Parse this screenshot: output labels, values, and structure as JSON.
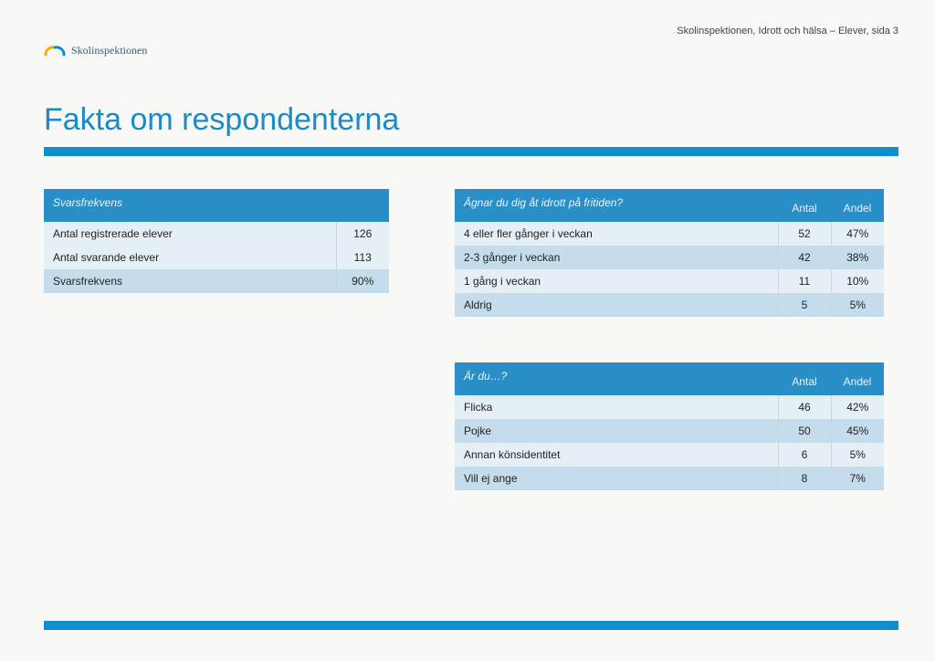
{
  "header": {
    "context": "Skolinspektionen, Idrott och hälsa – Elever, sida 3"
  },
  "brand": {
    "name": "Skolinspektionen"
  },
  "title": "Fakta om respondenterna",
  "table_left": {
    "header": "Svarsfrekvens",
    "rows": [
      {
        "label": "Antal registrerade elever",
        "value": "126"
      },
      {
        "label": "Antal svarande elever",
        "value": "113"
      },
      {
        "label": "Svarsfrekvens",
        "value": "90%"
      }
    ]
  },
  "table_sport": {
    "question": "Ägnar du dig åt idrott på fritiden?",
    "col1": "Antal",
    "col2": "Andel",
    "rows": [
      {
        "label": "4 eller fler gånger i veckan",
        "antal": "52",
        "andel": "47%"
      },
      {
        "label": "2-3 gånger i veckan",
        "antal": "42",
        "andel": "38%"
      },
      {
        "label": "1 gång i veckan",
        "antal": "11",
        "andel": "10%"
      },
      {
        "label": "Aldrig",
        "antal": "5",
        "andel": "5%"
      }
    ]
  },
  "table_gender": {
    "question": "Är du…?",
    "col1": "Antal",
    "col2": "Andel",
    "rows": [
      {
        "label": "Flicka",
        "antal": "46",
        "andel": "42%"
      },
      {
        "label": "Pojke",
        "antal": "50",
        "andel": "45%"
      },
      {
        "label": "Annan könsidentitet",
        "antal": "6",
        "andel": "5%"
      },
      {
        "label": "Vill ej ange",
        "antal": "8",
        "andel": "7%"
      }
    ]
  },
  "chart_data": [
    {
      "type": "table",
      "title": "Svarsfrekvens",
      "rows": [
        {
          "metric": "Antal registrerade elever",
          "value": 126
        },
        {
          "metric": "Antal svarande elever",
          "value": 113
        },
        {
          "metric": "Svarsfrekvens",
          "value": "90%"
        }
      ]
    },
    {
      "type": "table",
      "title": "Ägnar du dig åt idrott på fritiden?",
      "columns": [
        "",
        "Antal",
        "Andel"
      ],
      "rows": [
        [
          "4 eller fler gånger i veckan",
          52,
          "47%"
        ],
        [
          "2-3 gånger i veckan",
          42,
          "38%"
        ],
        [
          "1 gång i veckan",
          11,
          "10%"
        ],
        [
          "Aldrig",
          5,
          "5%"
        ]
      ]
    },
    {
      "type": "table",
      "title": "Är du…?",
      "columns": [
        "",
        "Antal",
        "Andel"
      ],
      "rows": [
        [
          "Flicka",
          46,
          "42%"
        ],
        [
          "Pojke",
          50,
          "45%"
        ],
        [
          "Annan könsidentitet",
          6,
          "5%"
        ],
        [
          "Vill ej ange",
          8,
          "7%"
        ]
      ]
    }
  ]
}
